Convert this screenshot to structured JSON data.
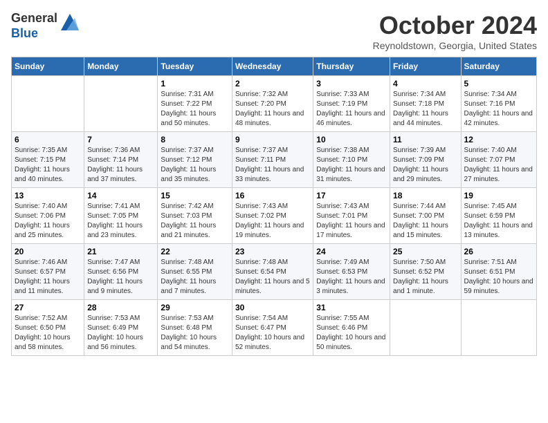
{
  "header": {
    "logo_line1": "General",
    "logo_line2": "Blue",
    "month_title": "October 2024",
    "location": "Reynoldstown, Georgia, United States"
  },
  "days_of_week": [
    "Sunday",
    "Monday",
    "Tuesday",
    "Wednesday",
    "Thursday",
    "Friday",
    "Saturday"
  ],
  "weeks": [
    [
      {
        "day": "",
        "sunrise": "",
        "sunset": "",
        "daylight": ""
      },
      {
        "day": "",
        "sunrise": "",
        "sunset": "",
        "daylight": ""
      },
      {
        "day": "1",
        "sunrise": "Sunrise: 7:31 AM",
        "sunset": "Sunset: 7:22 PM",
        "daylight": "Daylight: 11 hours and 50 minutes."
      },
      {
        "day": "2",
        "sunrise": "Sunrise: 7:32 AM",
        "sunset": "Sunset: 7:20 PM",
        "daylight": "Daylight: 11 hours and 48 minutes."
      },
      {
        "day": "3",
        "sunrise": "Sunrise: 7:33 AM",
        "sunset": "Sunset: 7:19 PM",
        "daylight": "Daylight: 11 hours and 46 minutes."
      },
      {
        "day": "4",
        "sunrise": "Sunrise: 7:34 AM",
        "sunset": "Sunset: 7:18 PM",
        "daylight": "Daylight: 11 hours and 44 minutes."
      },
      {
        "day": "5",
        "sunrise": "Sunrise: 7:34 AM",
        "sunset": "Sunset: 7:16 PM",
        "daylight": "Daylight: 11 hours and 42 minutes."
      }
    ],
    [
      {
        "day": "6",
        "sunrise": "Sunrise: 7:35 AM",
        "sunset": "Sunset: 7:15 PM",
        "daylight": "Daylight: 11 hours and 40 minutes."
      },
      {
        "day": "7",
        "sunrise": "Sunrise: 7:36 AM",
        "sunset": "Sunset: 7:14 PM",
        "daylight": "Daylight: 11 hours and 37 minutes."
      },
      {
        "day": "8",
        "sunrise": "Sunrise: 7:37 AM",
        "sunset": "Sunset: 7:12 PM",
        "daylight": "Daylight: 11 hours and 35 minutes."
      },
      {
        "day": "9",
        "sunrise": "Sunrise: 7:37 AM",
        "sunset": "Sunset: 7:11 PM",
        "daylight": "Daylight: 11 hours and 33 minutes."
      },
      {
        "day": "10",
        "sunrise": "Sunrise: 7:38 AM",
        "sunset": "Sunset: 7:10 PM",
        "daylight": "Daylight: 11 hours and 31 minutes."
      },
      {
        "day": "11",
        "sunrise": "Sunrise: 7:39 AM",
        "sunset": "Sunset: 7:09 PM",
        "daylight": "Daylight: 11 hours and 29 minutes."
      },
      {
        "day": "12",
        "sunrise": "Sunrise: 7:40 AM",
        "sunset": "Sunset: 7:07 PM",
        "daylight": "Daylight: 11 hours and 27 minutes."
      }
    ],
    [
      {
        "day": "13",
        "sunrise": "Sunrise: 7:40 AM",
        "sunset": "Sunset: 7:06 PM",
        "daylight": "Daylight: 11 hours and 25 minutes."
      },
      {
        "day": "14",
        "sunrise": "Sunrise: 7:41 AM",
        "sunset": "Sunset: 7:05 PM",
        "daylight": "Daylight: 11 hours and 23 minutes."
      },
      {
        "day": "15",
        "sunrise": "Sunrise: 7:42 AM",
        "sunset": "Sunset: 7:03 PM",
        "daylight": "Daylight: 11 hours and 21 minutes."
      },
      {
        "day": "16",
        "sunrise": "Sunrise: 7:43 AM",
        "sunset": "Sunset: 7:02 PM",
        "daylight": "Daylight: 11 hours and 19 minutes."
      },
      {
        "day": "17",
        "sunrise": "Sunrise: 7:43 AM",
        "sunset": "Sunset: 7:01 PM",
        "daylight": "Daylight: 11 hours and 17 minutes."
      },
      {
        "day": "18",
        "sunrise": "Sunrise: 7:44 AM",
        "sunset": "Sunset: 7:00 PM",
        "daylight": "Daylight: 11 hours and 15 minutes."
      },
      {
        "day": "19",
        "sunrise": "Sunrise: 7:45 AM",
        "sunset": "Sunset: 6:59 PM",
        "daylight": "Daylight: 11 hours and 13 minutes."
      }
    ],
    [
      {
        "day": "20",
        "sunrise": "Sunrise: 7:46 AM",
        "sunset": "Sunset: 6:57 PM",
        "daylight": "Daylight: 11 hours and 11 minutes."
      },
      {
        "day": "21",
        "sunrise": "Sunrise: 7:47 AM",
        "sunset": "Sunset: 6:56 PM",
        "daylight": "Daylight: 11 hours and 9 minutes."
      },
      {
        "day": "22",
        "sunrise": "Sunrise: 7:48 AM",
        "sunset": "Sunset: 6:55 PM",
        "daylight": "Daylight: 11 hours and 7 minutes."
      },
      {
        "day": "23",
        "sunrise": "Sunrise: 7:48 AM",
        "sunset": "Sunset: 6:54 PM",
        "daylight": "Daylight: 11 hours and 5 minutes."
      },
      {
        "day": "24",
        "sunrise": "Sunrise: 7:49 AM",
        "sunset": "Sunset: 6:53 PM",
        "daylight": "Daylight: 11 hours and 3 minutes."
      },
      {
        "day": "25",
        "sunrise": "Sunrise: 7:50 AM",
        "sunset": "Sunset: 6:52 PM",
        "daylight": "Daylight: 11 hours and 1 minute."
      },
      {
        "day": "26",
        "sunrise": "Sunrise: 7:51 AM",
        "sunset": "Sunset: 6:51 PM",
        "daylight": "Daylight: 10 hours and 59 minutes."
      }
    ],
    [
      {
        "day": "27",
        "sunrise": "Sunrise: 7:52 AM",
        "sunset": "Sunset: 6:50 PM",
        "daylight": "Daylight: 10 hours and 58 minutes."
      },
      {
        "day": "28",
        "sunrise": "Sunrise: 7:53 AM",
        "sunset": "Sunset: 6:49 PM",
        "daylight": "Daylight: 10 hours and 56 minutes."
      },
      {
        "day": "29",
        "sunrise": "Sunrise: 7:53 AM",
        "sunset": "Sunset: 6:48 PM",
        "daylight": "Daylight: 10 hours and 54 minutes."
      },
      {
        "day": "30",
        "sunrise": "Sunrise: 7:54 AM",
        "sunset": "Sunset: 6:47 PM",
        "daylight": "Daylight: 10 hours and 52 minutes."
      },
      {
        "day": "31",
        "sunrise": "Sunrise: 7:55 AM",
        "sunset": "Sunset: 6:46 PM",
        "daylight": "Daylight: 10 hours and 50 minutes."
      },
      {
        "day": "",
        "sunrise": "",
        "sunset": "",
        "daylight": ""
      },
      {
        "day": "",
        "sunrise": "",
        "sunset": "",
        "daylight": ""
      }
    ]
  ]
}
